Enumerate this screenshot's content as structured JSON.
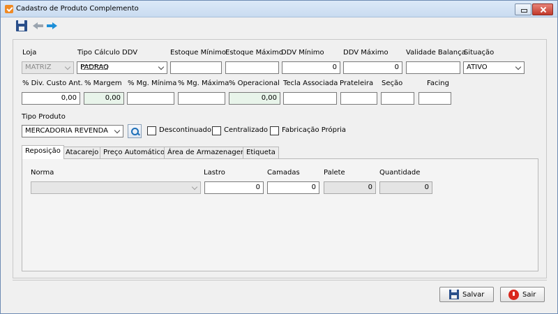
{
  "window": {
    "title": "Cadastro de Produto Complemento"
  },
  "toolbar": {
    "save": "save-icon",
    "back": "arrow-left-icon",
    "forward": "arrow-right-icon"
  },
  "row1": {
    "loja_label": "Loja",
    "loja_value": "MATRIZ",
    "tipo_calculo_label": "Tipo Cálculo DDV",
    "tipo_calculo_value": "PADRAO",
    "estoque_minimo_label": "Estoque Mínimo",
    "estoque_minimo_value": "",
    "estoque_maximo_label": "Estoque Máximo",
    "estoque_maximo_value": "",
    "ddv_minimo_label": "DDV Mínimo",
    "ddv_minimo_value": "0",
    "ddv_maximo_label": "DDV Máximo",
    "ddv_maximo_value": "0",
    "validade_label": "Validade Balança",
    "validade_value": "",
    "situacao_label": "Situação",
    "situacao_value": "ATIVO"
  },
  "row2": {
    "div_custo_label": "% Div. Custo Ant.",
    "div_custo_value": "0,00",
    "margem_label": "% Margem",
    "margem_value": "0,00",
    "mg_minima_label": "% Mg. Mínima",
    "mg_minima_value": "",
    "mg_maxima_label": "% Mg. Máxima",
    "mg_maxima_value": "",
    "operacional_label": "% Operacional",
    "operacional_value": "0,00",
    "tecla_label": "Tecla Associada",
    "tecla_value": "",
    "prateleira_label": "Prateleira",
    "prateleira_value": "",
    "secao_label": "Seção",
    "secao_value": "",
    "facing_label": "Facing",
    "facing_value": ""
  },
  "tipo_produto": {
    "label": "Tipo Produto",
    "value": "MERCADORIA REVENDA",
    "descontinuado": "Descontinuado",
    "centralizado": "Centralizado",
    "fabricacao": "Fabricação Própria"
  },
  "tabs": [
    {
      "label": "Reposição"
    },
    {
      "label": "Atacarejo"
    },
    {
      "label": "Preço Automático"
    },
    {
      "label": "Área de Armazenagem"
    },
    {
      "label": "Etiqueta"
    }
  ],
  "reposicao": {
    "norma_label": "Norma",
    "norma_value": "",
    "lastro_label": "Lastro",
    "lastro_value": "0",
    "camadas_label": "Camadas",
    "camadas_value": "0",
    "palete_label": "Palete",
    "palete_value": "0",
    "quantidade_label": "Quantidade",
    "quantidade_value": "0"
  },
  "buttons": {
    "save": "Salvar",
    "exit": "Sair"
  }
}
